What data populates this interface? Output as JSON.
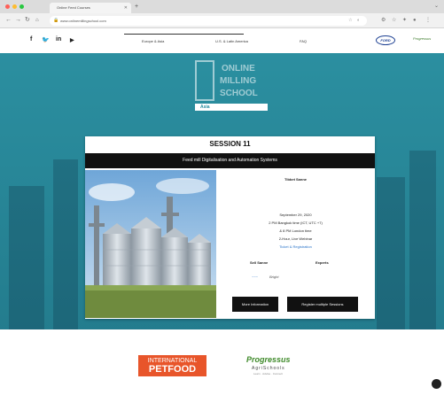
{
  "browser": {
    "tab_title": "Online Feed Courses",
    "new_tab": "+",
    "tab_menu": "⌄",
    "url": "www.onlinemillingschool.com",
    "url_tools": "☆ ◐",
    "dots": [
      "#ff5f57",
      "#febc2e",
      "#28c840"
    ]
  },
  "header": {
    "nav": [
      "Europe & Asia",
      "U.S. & Latin America",
      "FAQ"
    ],
    "social": [
      "f",
      "🐦",
      "in",
      "▶"
    ],
    "sponsor_a": "FORD",
    "sponsor_b": "Progressus"
  },
  "logo": {
    "lines": [
      "ONLINE",
      "MILLING",
      "SCHOOL"
    ],
    "bar": "Asia"
  },
  "session": {
    "title": "SESSION 11",
    "subtitle": "Feed mill Digitalisation and Automation Systems",
    "field_label": "Tibbet Sanne",
    "date": "September 29, 2020",
    "time": "2 PM Bangkok time (ICT, UTC +7)",
    "session_time": "& 8 PM London time",
    "duration": "2-Hour, Live Webinar",
    "link": "Ticket & Registration",
    "label_sell": "Sell Sanne",
    "label_experts": "Experts",
    "expert_logo_a": "~~~",
    "expert_logo_b": "Bright",
    "btn_info": "More Information",
    "btn_register": "Register multiple Sessions"
  },
  "sponsors": {
    "petfood_top": "INTERNATIONAL",
    "petfood_bottom": "PETFOOD",
    "progressus_name": "Progressus",
    "progressus_sub": "AgriSchools",
    "progressus_tag": "Learn · Advise · Connect"
  }
}
